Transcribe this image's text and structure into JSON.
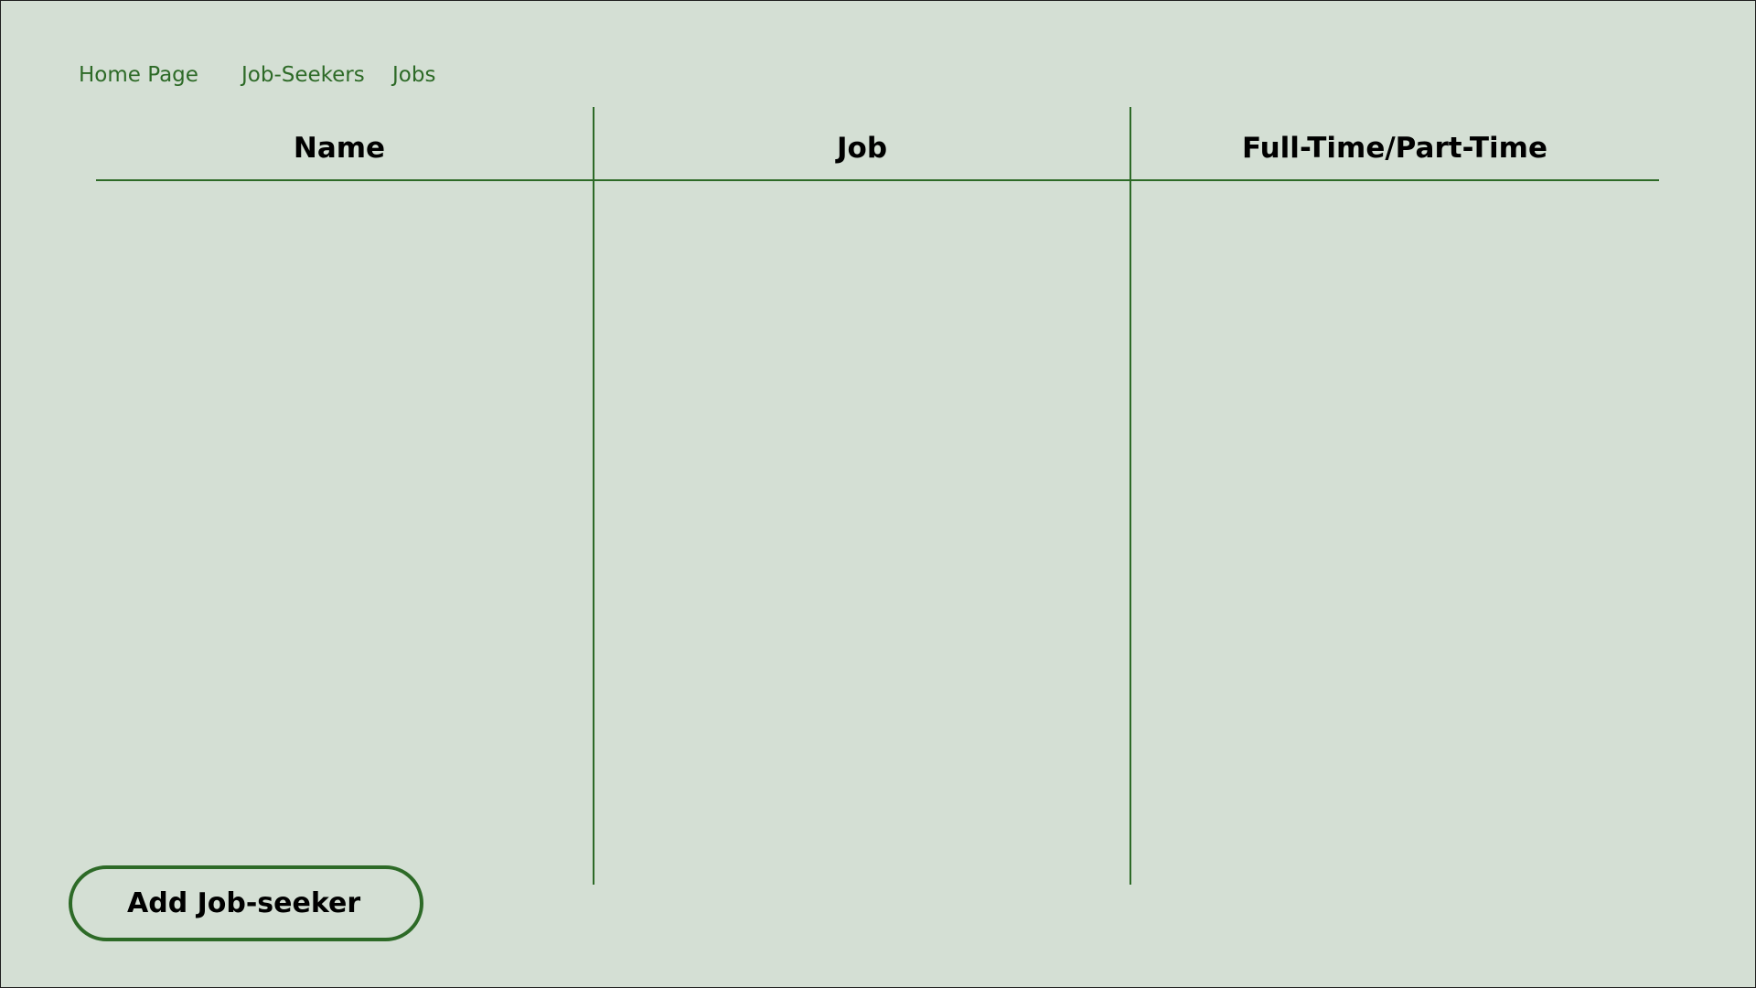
{
  "nav": {
    "home": "Home Page",
    "job_seekers": "Job-Seekers",
    "jobs": "Jobs"
  },
  "table": {
    "columns": [
      "Name",
      "Job",
      "Full-Time/Part-Time"
    ],
    "rows": []
  },
  "actions": {
    "add_label": "Add Job-seeker"
  },
  "colors": {
    "background": "#d4dfd4",
    "accent": "#2d6a27",
    "text": "#000000"
  }
}
